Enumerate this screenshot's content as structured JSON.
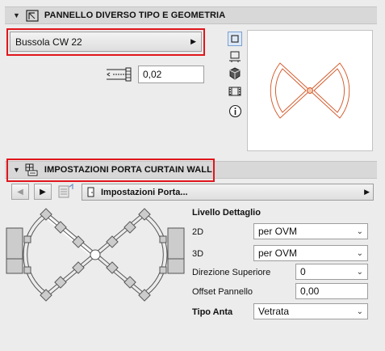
{
  "panel1": {
    "title": "PANNELLO DIVERSO TIPO E GEOMETRIA",
    "type_selector": "Bussola CW 22",
    "offset_value": "0,02",
    "preview_icons": [
      "square-view-icon",
      "floor-plan-icon",
      "3d-box-icon",
      "film-strip-icon",
      "info-icon"
    ]
  },
  "panel2": {
    "title": "IMPOSTAZIONI PORTA CURTAIN WALL",
    "page_selector": "Impostazioni Porta...",
    "settings": {
      "detail_heading": "Livello Dettaglio",
      "row_2d_label": "2D",
      "row_2d_value": "per OVM",
      "row_3d_label": "3D",
      "row_3d_value": "per OVM",
      "direction_label": "Direzione Superiore",
      "direction_value": "0",
      "offset_label": "Offset Pannello",
      "offset_value": "0,00",
      "leaf_label": "Tipo Anta",
      "leaf_value": "Vetrata"
    }
  },
  "colors": {
    "highlight": "#e0161c",
    "preview_line": "#d2501e",
    "header_bg": "#d8d8d8"
  }
}
